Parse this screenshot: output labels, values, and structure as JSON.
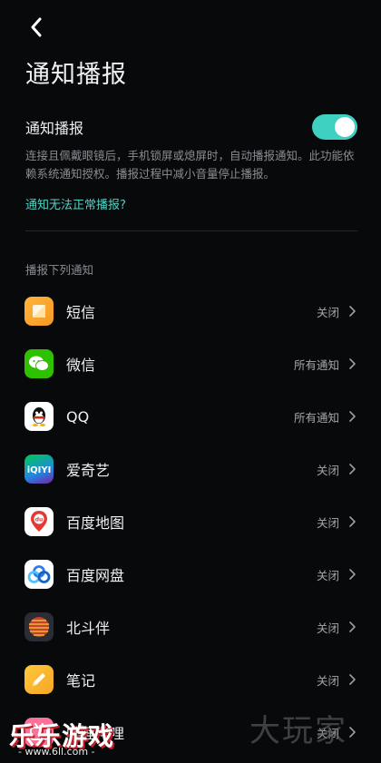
{
  "page": {
    "title": "通知播报"
  },
  "toggle": {
    "label": "通知播报",
    "state": "on",
    "accent_color": "#3ed0c0"
  },
  "description": "连接且佩戴眼镜后，手机锁屏或熄屏时，自动播报通知。此功能依赖系统通知授权。播报过程中减小音量停止播报。",
  "help_link": "通知无法正常播报?",
  "section_label": "播报下列通知",
  "apps": [
    {
      "name": "短信",
      "status": "关闭",
      "icon": "sms-icon"
    },
    {
      "name": "微信",
      "status": "所有通知",
      "icon": "wechat-icon"
    },
    {
      "name": "QQ",
      "status": "所有通知",
      "icon": "qq-icon"
    },
    {
      "name": "爱奇艺",
      "status": "关闭",
      "icon": "iqiyi-icon"
    },
    {
      "name": "百度地图",
      "status": "关闭",
      "icon": "baidu-map-icon"
    },
    {
      "name": "百度网盘",
      "status": "关闭",
      "icon": "baidu-netdisk-icon"
    },
    {
      "name": "北斗伴",
      "status": "关闭",
      "icon": "beidou-icon"
    },
    {
      "name": "笔记",
      "status": "关闭",
      "icon": "notes-icon"
    },
    {
      "name": "哔哩哔哩",
      "status": "关闭",
      "icon": "bilibili-icon"
    }
  ],
  "watermarks": {
    "left": "乐乐游戏",
    "left_url": "- www.6ll.com -",
    "right": "大玩家"
  }
}
